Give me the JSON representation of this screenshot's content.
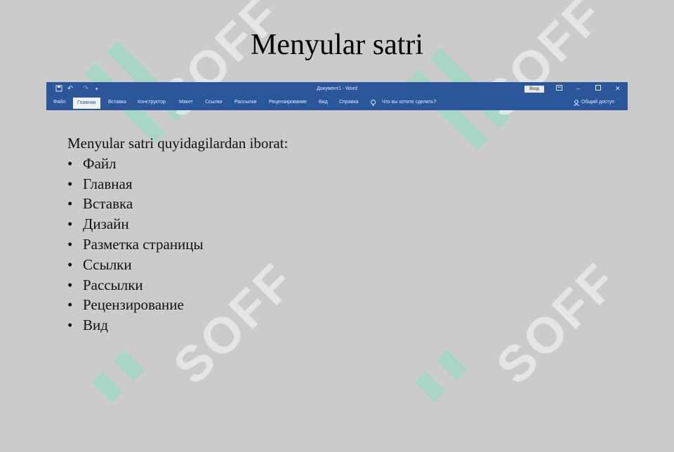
{
  "slide": {
    "title": "Menyular satri",
    "intro": "Menyular satri quyidagilardan iborat:",
    "items": [
      "Файл",
      "Главная",
      "Вставка",
      "Дизайн",
      "Разметка страницы",
      "Ссылки",
      "Рассылки",
      "Рецензирование",
      "Вид"
    ]
  },
  "ribbon": {
    "doc_title": "Документ1  -  Word",
    "signin": "Вход",
    "tabs": [
      "Файл",
      "Главная",
      "Вставка",
      "Конструктор",
      "Макет",
      "Ссылки",
      "Рассылки",
      "Рецензирование",
      "Вид",
      "Справка"
    ],
    "active_tab": "Главная",
    "tell_me": "Что вы хотите сделать?",
    "share": "Общий доступ",
    "icons": [
      "save-icon",
      "undo-icon",
      "redo-icon",
      "customize-icon",
      "lightbulb-icon",
      "ribbon-display-icon",
      "minimize-icon",
      "maximize-icon",
      "close-icon",
      "person-icon"
    ]
  },
  "watermark": {
    "text": "SOFF"
  },
  "colors": {
    "ribbon": "#2b579a",
    "background": "#cbcbcb",
    "watermark_logo": "#8ce0c0"
  }
}
